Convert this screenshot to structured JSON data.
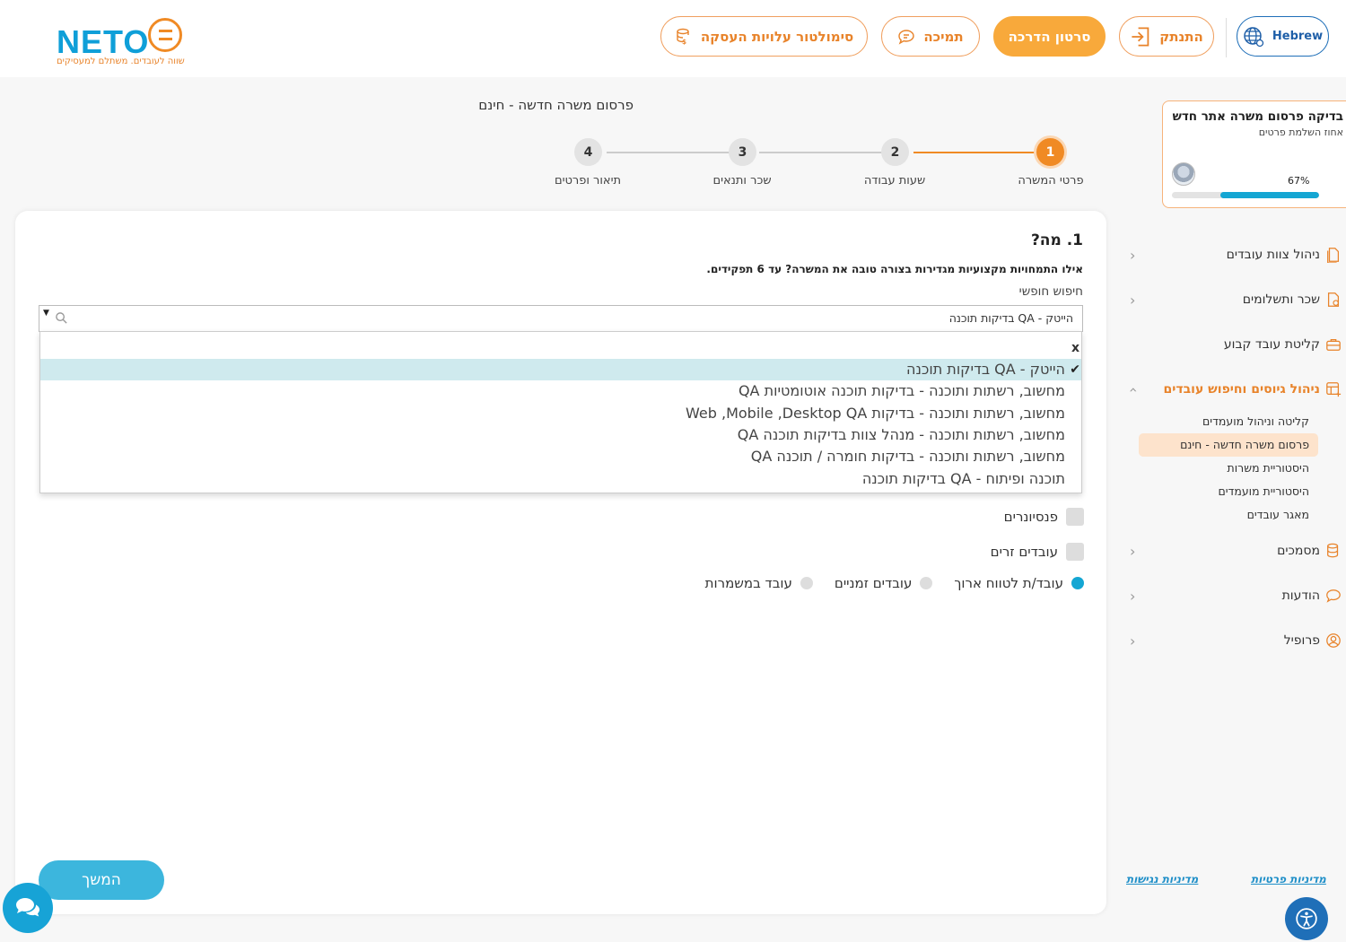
{
  "header": {
    "logo_text": "NETO",
    "logo_tagline": "שווה לעובדים. משתלם למעסיקים",
    "language_label": "Hebrew",
    "logout_label": "התנתק",
    "guide_label": "סרטון הדרכה",
    "support_label": "תמיכה",
    "simulator_label": "סימולטור עלויות העסקה"
  },
  "progress_card": {
    "title": "בדיקה פרסום משרה אתר חדש",
    "subtitle": "אחוז השלמת פרטים",
    "percent_label": "67%",
    "percent": 67
  },
  "sidebar": {
    "items": [
      {
        "label": "ניהול צוות עובדים",
        "icon": "document-icon"
      },
      {
        "label": "שכר ותשלומים",
        "icon": "payslip-icon"
      },
      {
        "label": "קליטת עובד קבוע",
        "icon": "briefcase-icon"
      },
      {
        "label": "ניהול גיוסים וחיפוש עובדים",
        "icon": "table-add-icon"
      },
      {
        "label": "מסמכים",
        "icon": "database-icon"
      },
      {
        "label": "הודעות",
        "icon": "chat-icon"
      },
      {
        "label": "פרופיל",
        "icon": "user-circle-icon"
      }
    ],
    "subitems": [
      {
        "label": "קליטה וניהול מועמדים"
      },
      {
        "label": "פרסום משרה חדשה - חינם"
      },
      {
        "label": "היסטוריית משרות"
      },
      {
        "label": "היסטוריית מועמדים"
      },
      {
        "label": "מאגר עובדים"
      }
    ],
    "footer": {
      "privacy": "מדיניות פרטיות",
      "accessibility": "מדיניות נגישות"
    }
  },
  "page": {
    "title": "פרסום משרה חדשה - חינם",
    "steps": [
      {
        "number": "1",
        "label": "פרטי המשרה"
      },
      {
        "number": "2",
        "label": "שעות עבודה"
      },
      {
        "number": "3",
        "label": "שכר ותנאים"
      },
      {
        "number": "4",
        "label": "תיאור ופרטים"
      }
    ]
  },
  "form": {
    "question_title": "1. מה?",
    "question_hint": "אילו התמחויות מקצועיות מגדירות בצורה טובה את המשרה? עד 6 תפקידים.",
    "search_label": "חיפוש חופשי",
    "selected_value": "הייטק - QA בדיקות תוכנה",
    "dropdown_close": "x",
    "dropdown_options": [
      {
        "label": "הייטק - QA בדיקות תוכנה"
      },
      {
        "label": "מחשוב, רשתות ותוכנה - בדיקות תוכנה אוטומטיות QA"
      },
      {
        "label": "מחשוב, רשתות ותוכנה - בדיקות Web ,Mobile ,Desktop QA"
      },
      {
        "label": "מחשוב, רשתות ותוכנה - מנהל צוות בדיקות תוכנה QA"
      },
      {
        "label": "מחשוב, רשתות ותוכנה - בדיקות חומרה / תוכנה QA"
      },
      {
        "label": "תוכנה ופיתוח - QA בדיקות תוכנה"
      }
    ],
    "checkboxes": [
      {
        "label": "פנסיונרים"
      },
      {
        "label": "עובדים זרים"
      }
    ],
    "radios": [
      {
        "label": "עובד/ת לטווח ארוך"
      },
      {
        "label": "עובדים זמניים"
      },
      {
        "label": "עובד במשמרות"
      }
    ],
    "continue_label": "המשך"
  },
  "colors": {
    "accent_orange": "#f08a24",
    "accent_blue": "#14a6d3",
    "selected_option_bg": "#cfeaee"
  }
}
